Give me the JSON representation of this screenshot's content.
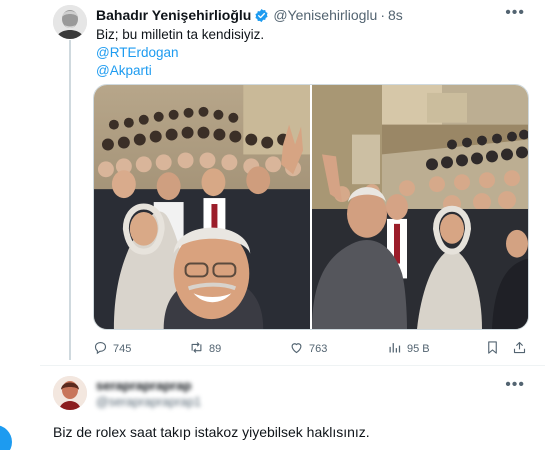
{
  "tweet": {
    "author_name": "Bahadır Yenişehirlioğlu",
    "handle": "@Yenisehirlioglu",
    "separator": "·",
    "time": "8s",
    "text_line": "Biz; bu milletin ta kendisiyiz.",
    "mentions": [
      "@RTErdogan",
      "@Akparti"
    ],
    "verified_icon": "verified-badge-icon",
    "stats": {
      "replies": "745",
      "reposts": "89",
      "likes": "763",
      "views": "95 B"
    },
    "colors": {
      "accent": "#1d9bf0",
      "muted": "#536471",
      "text": "#0f1419"
    }
  },
  "reply": {
    "author_name": "seraprapraprap",
    "handle": "@seraprapraprap1",
    "text": "Biz de rolex saat takıp istakoz yiyebilsek haklısınız."
  },
  "icons": {
    "more": "more-options-icon",
    "reply": "reply-icon",
    "repost": "repost-icon",
    "like": "heart-icon",
    "views": "views-chart-icon",
    "bookmark": "bookmark-icon",
    "share": "share-icon"
  }
}
